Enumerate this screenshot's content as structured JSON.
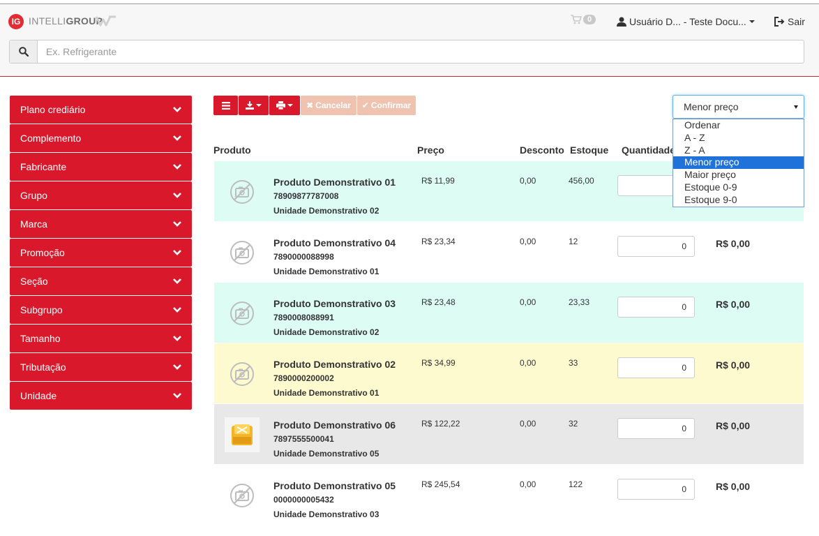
{
  "header": {
    "logo_badge": "IG",
    "logo_text_light": "INTELLI",
    "logo_text_bold": "GROUP",
    "cart_count": "0",
    "user_label": "Usuário D... - Teste Docu...",
    "logout_label": "Sair"
  },
  "search": {
    "placeholder": "Ex. Refrigerante"
  },
  "sidebar": {
    "items": [
      {
        "label": "Plano crediário"
      },
      {
        "label": "Complemento"
      },
      {
        "label": "Fabricante"
      },
      {
        "label": "Grupo"
      },
      {
        "label": "Marca"
      },
      {
        "label": "Promoção"
      },
      {
        "label": "Seção"
      },
      {
        "label": "Subgrupo"
      },
      {
        "label": "Tamanho"
      },
      {
        "label": "Tributação"
      },
      {
        "label": "Unidade"
      }
    ]
  },
  "toolbar": {
    "cancel_label": "Cancelar",
    "confirm_label": "Confirmar"
  },
  "sort": {
    "selected": "Menor preço",
    "options": [
      "Ordenar",
      "A - Z",
      "Z - A",
      "Menor preço",
      "Maior preço",
      "Estoque 0-9",
      "Estoque 9-0"
    ]
  },
  "table": {
    "headers": {
      "product": "Produto",
      "price": "Preço",
      "discount": "Desconto",
      "stock": "Estoque",
      "quantity": "Quantidade"
    },
    "rows": [
      {
        "name": "Produto Demonstrativo 01",
        "code": "78909877787008",
        "unit": "Unidade Demonstrativo 02",
        "price": "R$ 11,99",
        "discount": "0,00",
        "stock": "456,00",
        "qty": "",
        "total": "",
        "bg": "#dcfcf4",
        "image": "no-photo-icon"
      },
      {
        "name": "Produto Demonstrativo 04",
        "code": "7890000088998",
        "unit": "Unidade Demonstrativo 01",
        "price": "R$ 23,34",
        "discount": "0,00",
        "stock": "12",
        "qty": "0",
        "total": "R$ 0,00",
        "bg": "#ffffff",
        "image": "no-photo-icon"
      },
      {
        "name": "Produto Demonstrativo 03",
        "code": "7890008088991",
        "unit": "Unidade Demonstrativo 02",
        "price": "R$ 23,48",
        "discount": "0,00",
        "stock": "23,33",
        "qty": "0",
        "total": "R$ 0,00",
        "bg": "#dcfcf4",
        "image": "no-photo-icon"
      },
      {
        "name": "Produto Demonstrativo 02",
        "code": "7890000200002",
        "unit": "Unidade Demonstrativo 01",
        "price": "R$ 34,99",
        "discount": "0,00",
        "stock": "33",
        "qty": "0",
        "total": "R$ 0,00",
        "bg": "#fdfad0",
        "image": "no-photo-icon"
      },
      {
        "name": "Produto Demonstrativo 06",
        "code": "7897555500041",
        "unit": "Unidade Demonstrativo 05",
        "price": "R$ 122,22",
        "discount": "0,00",
        "stock": "32",
        "qty": "0",
        "total": "R$ 0,00",
        "bg": "#e8e8e8",
        "image": "product-box-icon"
      },
      {
        "name": "Produto Demonstrativo 05",
        "code": "0000000005432",
        "unit": "Unidade Demonstrativo 03",
        "price": "R$ 245,54",
        "discount": "0,00",
        "stock": "122",
        "qty": "0",
        "total": "R$ 0,00",
        "bg": "#ffffff",
        "image": "no-photo-icon"
      }
    ]
  },
  "colors": {
    "brand_red": "#d9192b",
    "disabled_btn": "#f0c3b0",
    "select_focus": "#66afe9",
    "option_selected": "#1e72d9"
  }
}
